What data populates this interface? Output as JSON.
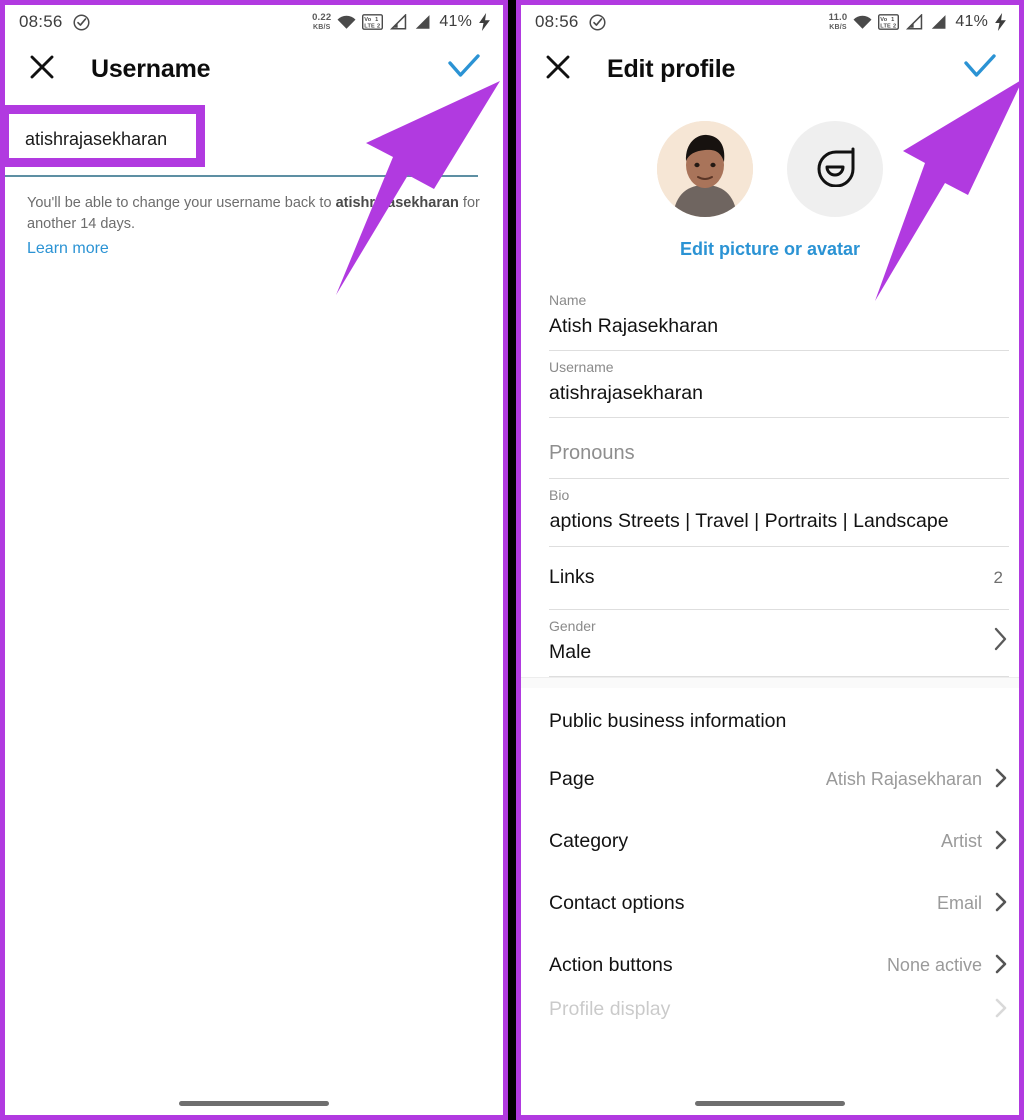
{
  "left": {
    "status": {
      "time": "08:56",
      "net_speed_value": "0.22",
      "net_speed_unit": "KB/S",
      "volte": "VoLTE",
      "battery": "41%"
    },
    "appbar": {
      "title": "Username",
      "close_icon": "close-icon",
      "confirm_icon": "check-icon"
    },
    "username_value": "atishrajasekharan",
    "helper_prefix": "You'll be able to change your username back to ",
    "helper_bold": "atishrajasekharan",
    "helper_suffix": " for another 14 days.",
    "learn_more": "Learn more"
  },
  "right": {
    "status": {
      "time": "08:56",
      "net_speed_value": "11.0",
      "net_speed_unit": "KB/S",
      "volte": "VoLTE",
      "battery": "41%"
    },
    "appbar": {
      "title": "Edit profile",
      "close_icon": "close-icon",
      "confirm_icon": "check-icon"
    },
    "edit_picture_link": "Edit picture or avatar",
    "fields": [
      {
        "label": "Name",
        "value": "Atish Rajasekharan",
        "type": "text"
      },
      {
        "label": "Username",
        "value": "atishrajasekharan",
        "type": "text"
      },
      {
        "label": "",
        "value": "Pronouns",
        "type": "placeholder"
      },
      {
        "label": "Bio",
        "value": "le Captions Streets | Travel | Portraits | Landscape",
        "type": "bio"
      }
    ],
    "links_row": {
      "label": "Links",
      "count": "2"
    },
    "gender_row": {
      "label": "Gender",
      "value": "Male",
      "chevron": "chevron-right-icon"
    },
    "business_section": {
      "heading": "Public business information",
      "rows": [
        {
          "label": "Page",
          "value": "Atish Rajasekharan",
          "chevron": "chevron-right-icon"
        },
        {
          "label": "Category",
          "value": "Artist",
          "chevron": "chevron-right-icon"
        },
        {
          "label": "Contact options",
          "value": "Email",
          "chevron": "chevron-right-icon"
        },
        {
          "label": "Action buttons",
          "value": "None active",
          "chevron": "chevron-right-icon"
        },
        {
          "label": "Profile display",
          "value": "",
          "chevron": "chevron-right-icon"
        }
      ]
    }
  },
  "colors": {
    "annotation_purple": "#b13ae0",
    "link_blue": "#2b93d4",
    "check_blue": "#2b93d4",
    "underline_teal": "#5d8fa3"
  }
}
